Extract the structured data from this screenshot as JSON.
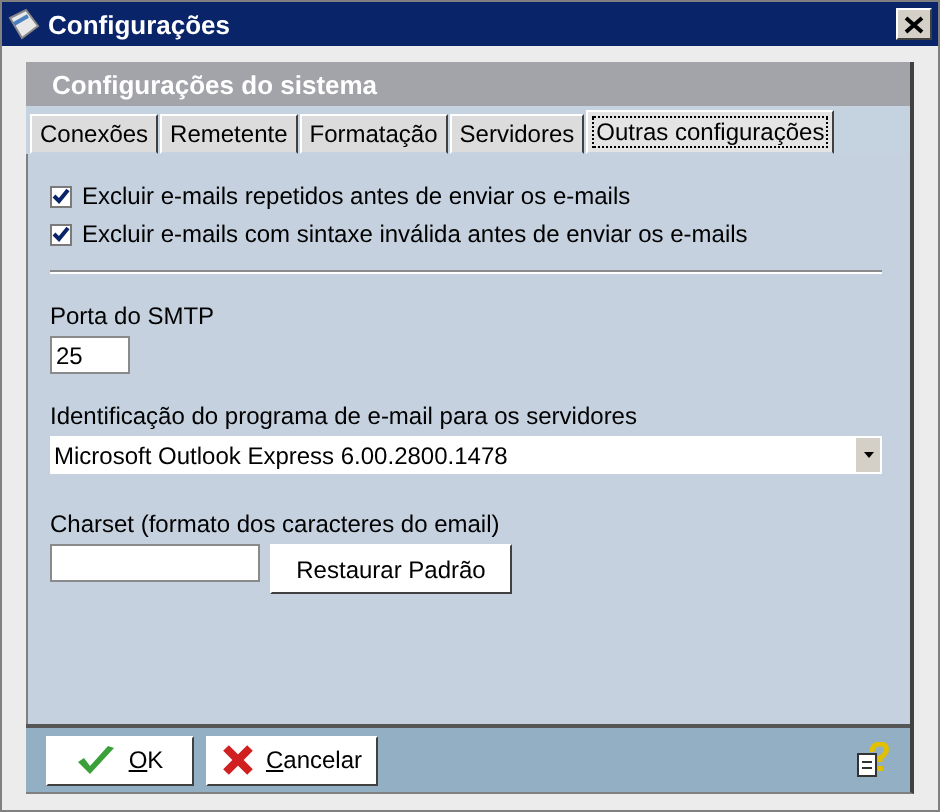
{
  "window": {
    "title": "Configurações"
  },
  "panel": {
    "title": "Configurações do sistema"
  },
  "tabs": [
    {
      "label": "Conexões",
      "selected": false
    },
    {
      "label": "Remetente",
      "selected": false
    },
    {
      "label": "Formatação",
      "selected": false
    },
    {
      "label": "Servidores",
      "selected": false
    },
    {
      "label": "Outras configurações",
      "selected": true
    }
  ],
  "options": [
    {
      "label": "Excluir e-mails repetidos antes de enviar os e-mails",
      "checked": true
    },
    {
      "label": "Excluir e-mails com sintaxe inválida antes de enviar os e-mails",
      "checked": true
    }
  ],
  "smtp_port": {
    "label": "Porta do SMTP",
    "value": "25"
  },
  "mail_program": {
    "label": "Identificação do programa de e-mail para os servidores",
    "value": "Microsoft Outlook Express 6.00.2800.1478"
  },
  "charset": {
    "label": "Charset (formato dos caracteres do email)",
    "button": "Restaurar Padrão"
  },
  "buttons": [
    {
      "kind": "ok",
      "label": "OK"
    },
    {
      "kind": "cancel",
      "label": "Cancelar"
    }
  ]
}
